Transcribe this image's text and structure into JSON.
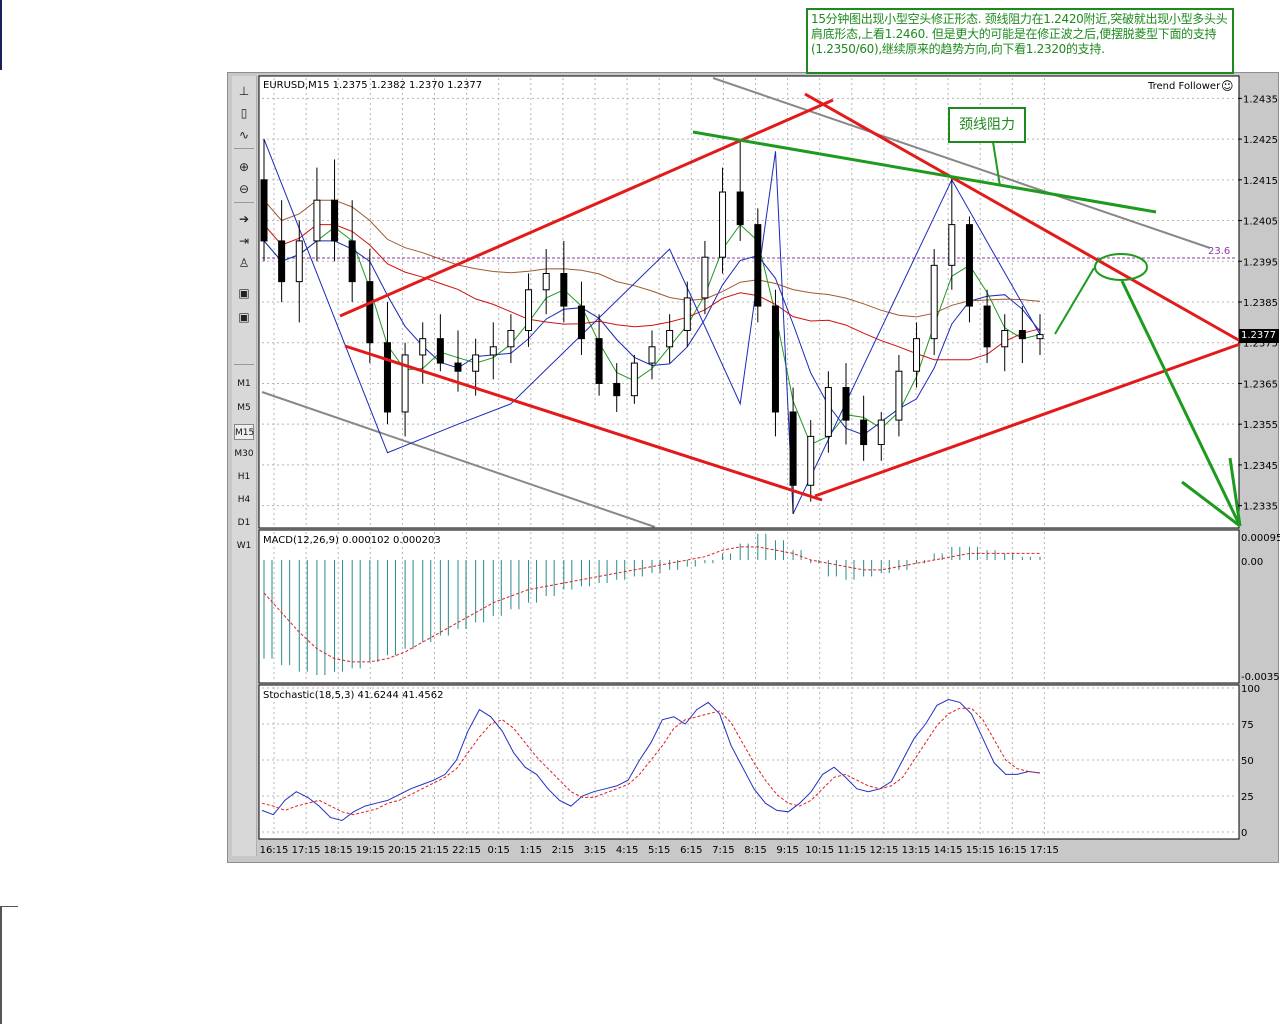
{
  "chart_data": [
    {
      "type": "candlestick",
      "symbol_header": "EURUSD,M15  1.2375 1.2382 1.2370 1.2377",
      "indicator_label": "Trend Follower",
      "current_price": "1.2377",
      "fib_label": "23.6",
      "y_ticks": [
        "1.2435",
        "1.2425",
        "1.2415",
        "1.2405",
        "1.2395",
        "1.2385",
        "1.2375",
        "1.2365",
        "1.2355",
        "1.2345",
        "1.2335"
      ],
      "x_ticks": [
        "16:15",
        "17:15",
        "18:15",
        "19:15",
        "20:15",
        "21:15",
        "22:15",
        "0:15",
        "1:15",
        "2:15",
        "3:15",
        "4:15",
        "5:15",
        "6:15",
        "7:15",
        "8:15",
        "9:15",
        "10:15",
        "11:15",
        "12:15",
        "13:15",
        "14:15",
        "15:15",
        "16:15",
        "17:15"
      ],
      "ylim": [
        1.233,
        1.244
      ],
      "candles_approx": [
        [
          1.2415,
          1.2425,
          1.2395,
          1.24
        ],
        [
          1.24,
          1.241,
          1.2385,
          1.239
        ],
        [
          1.239,
          1.2405,
          1.238,
          1.24
        ],
        [
          1.24,
          1.2418,
          1.2395,
          1.241
        ],
        [
          1.241,
          1.242,
          1.2395,
          1.24
        ],
        [
          1.24,
          1.241,
          1.2385,
          1.239
        ],
        [
          1.239,
          1.2398,
          1.237,
          1.2375
        ],
        [
          1.2375,
          1.2385,
          1.2355,
          1.2358
        ],
        [
          1.2358,
          1.2375,
          1.2352,
          1.2372
        ],
        [
          1.2372,
          1.238,
          1.2365,
          1.2376
        ],
        [
          1.2376,
          1.2382,
          1.2368,
          1.237
        ],
        [
          1.237,
          1.2378,
          1.2363,
          1.2368
        ],
        [
          1.2368,
          1.2376,
          1.2362,
          1.2372
        ],
        [
          1.2372,
          1.238,
          1.2366,
          1.2374
        ],
        [
          1.2374,
          1.2382,
          1.237,
          1.2378
        ],
        [
          1.2378,
          1.2392,
          1.2374,
          1.2388
        ],
        [
          1.2388,
          1.2398,
          1.2382,
          1.2392
        ],
        [
          1.2392,
          1.24,
          1.238,
          1.2384
        ],
        [
          1.2384,
          1.239,
          1.2372,
          1.2376
        ],
        [
          1.2376,
          1.2382,
          1.2362,
          1.2365
        ],
        [
          1.2365,
          1.237,
          1.2358,
          1.2362
        ],
        [
          1.2362,
          1.2372,
          1.236,
          1.237
        ],
        [
          1.237,
          1.2378,
          1.2366,
          1.2374
        ],
        [
          1.2374,
          1.2382,
          1.237,
          1.2378
        ],
        [
          1.2378,
          1.239,
          1.2374,
          1.2386
        ],
        [
          1.2386,
          1.24,
          1.2382,
          1.2396
        ],
        [
          1.2396,
          1.2418,
          1.2392,
          1.2412
        ],
        [
          1.2412,
          1.2425,
          1.24,
          1.2404
        ],
        [
          1.2404,
          1.2408,
          1.238,
          1.2384
        ],
        [
          1.2384,
          1.2388,
          1.2352,
          1.2358
        ],
        [
          1.2358,
          1.2364,
          1.2333,
          1.234
        ],
        [
          1.234,
          1.2356,
          1.2336,
          1.2352
        ],
        [
          1.2352,
          1.2368,
          1.2348,
          1.2364
        ],
        [
          1.2364,
          1.237,
          1.235,
          1.2356
        ],
        [
          1.2356,
          1.2362,
          1.2346,
          1.235
        ],
        [
          1.235,
          1.2358,
          1.2346,
          1.2356
        ],
        [
          1.2356,
          1.2372,
          1.2352,
          1.2368
        ],
        [
          1.2368,
          1.238,
          1.2364,
          1.2376
        ],
        [
          1.2376,
          1.2398,
          1.2372,
          1.2394
        ],
        [
          1.2394,
          1.2416,
          1.2388,
          1.2404
        ],
        [
          1.2404,
          1.2406,
          1.238,
          1.2384
        ],
        [
          1.2384,
          1.2388,
          1.237,
          1.2374
        ],
        [
          1.2374,
          1.2382,
          1.2368,
          1.2378
        ],
        [
          1.2378,
          1.2384,
          1.237,
          1.2376
        ],
        [
          1.2376,
          1.2382,
          1.2372,
          1.2377
        ]
      ],
      "annotation_text": "15分钟图出现小型空头修正形态. 颈线阻力在1.2420附近,突破就出现小型多头头肩底形态,上看1.2460. 但是更大的可能是在修正波之后,便摆脱菱型下面的支持(1.2350/60),继续原来的趋势方向,向下看1.2320的支持.",
      "neckline_label": "颈线阻力"
    },
    {
      "type": "bar",
      "label": "MACD(12,26,9)  0.000102  0.000203",
      "y_ticks": [
        "0.00095",
        "0.00",
        "-0.0035"
      ],
      "macd_hist": [
        -0.003,
        -0.0032,
        -0.0034,
        -0.0035,
        -0.0034,
        -0.0033,
        -0.0031,
        -0.0029,
        -0.0027,
        -0.0025,
        -0.0023,
        -0.0021,
        -0.0019,
        -0.0017,
        -0.0015,
        -0.0013,
        -0.0011,
        -0.0009,
        -0.0008,
        -0.0007,
        -0.0006,
        -0.0005,
        -0.0004,
        -0.0003,
        -0.0002,
        -0.0001,
        0.0002,
        0.0005,
        0.0008,
        0.0006,
        0.0003,
        -0.0001,
        -0.0005,
        -0.0006,
        -0.0005,
        -0.0004,
        -0.0003,
        -0.0001,
        0.0002,
        0.0004,
        0.0004,
        0.0003,
        0.0002,
        0.0001,
        0.0001
      ],
      "signal": [
        -0.001,
        -0.0016,
        -0.0022,
        -0.0027,
        -0.003,
        -0.0031,
        -0.0031,
        -0.003,
        -0.0028,
        -0.0025,
        -0.0022,
        -0.0019,
        -0.0016,
        -0.0013,
        -0.0011,
        -0.0009,
        -0.0008,
        -0.0007,
        -0.0006,
        -0.0005,
        -0.0004,
        -0.0003,
        -0.0002,
        -0.0001,
        0.0,
        0.0001,
        0.0003,
        0.0004,
        0.0004,
        0.0003,
        0.0002,
        0.0,
        -0.0001,
        -0.0002,
        -0.0003,
        -0.0003,
        -0.0002,
        -0.0001,
        0.0,
        0.0001,
        0.0002,
        0.0002,
        0.0002,
        0.0002,
        0.0002
      ]
    },
    {
      "type": "line",
      "label": "Stochastic(18,5,3)  41.6244  41.4562",
      "y_ticks": [
        "100",
        "75",
        "50",
        "25",
        "0"
      ],
      "ylim": [
        0,
        100
      ],
      "series": [
        {
          "values": [
            15,
            12,
            22,
            28,
            24,
            18,
            10,
            8,
            14,
            18,
            20,
            22,
            26,
            30,
            33,
            36,
            40,
            50,
            70,
            85,
            80,
            70,
            55,
            45,
            40,
            30,
            22,
            18,
            25,
            28,
            30,
            32,
            36,
            50,
            62,
            78,
            80,
            75,
            85,
            90,
            82,
            60,
            45,
            30,
            20,
            15,
            14,
            20,
            28,
            40,
            45,
            38,
            30,
            28,
            30,
            35,
            50,
            65,
            75,
            88,
            92,
            90,
            82,
            65,
            48,
            40,
            40,
            42,
            41
          ]
        },
        {
          "values": [
            20,
            18,
            15,
            18,
            20,
            22,
            18,
            14,
            12,
            14,
            16,
            20,
            22,
            26,
            30,
            34,
            38,
            44,
            55,
            66,
            75,
            78,
            72,
            62,
            52,
            44,
            36,
            28,
            24,
            24,
            27,
            30,
            33,
            40,
            50,
            60,
            72,
            78,
            80,
            82,
            84,
            76,
            62,
            48,
            36,
            26,
            20,
            18,
            22,
            30,
            38,
            40,
            36,
            32,
            30,
            32,
            38,
            50,
            62,
            74,
            82,
            86,
            86,
            78,
            64,
            50,
            44,
            42,
            41
          ]
        }
      ]
    }
  ],
  "toolbar": {
    "timeframes": [
      "M1",
      "M5",
      "M15",
      "M30",
      "H1",
      "H4",
      "D1",
      "W1"
    ],
    "active_timeframe": "M15"
  },
  "colors": {
    "red_line": "#e31a1a",
    "green_line": "#1e9a1e",
    "up_candle": "#ffffff",
    "down_candle": "#000000",
    "ma_blue": "#1a2ab8",
    "ma_red": "#d01010",
    "ma_brown": "#a05a30",
    "macd_hist": "#2a8a8a",
    "macd_signal": "#e02020",
    "stoch_main": "#2030c0",
    "stoch_signal": "#e02020"
  }
}
